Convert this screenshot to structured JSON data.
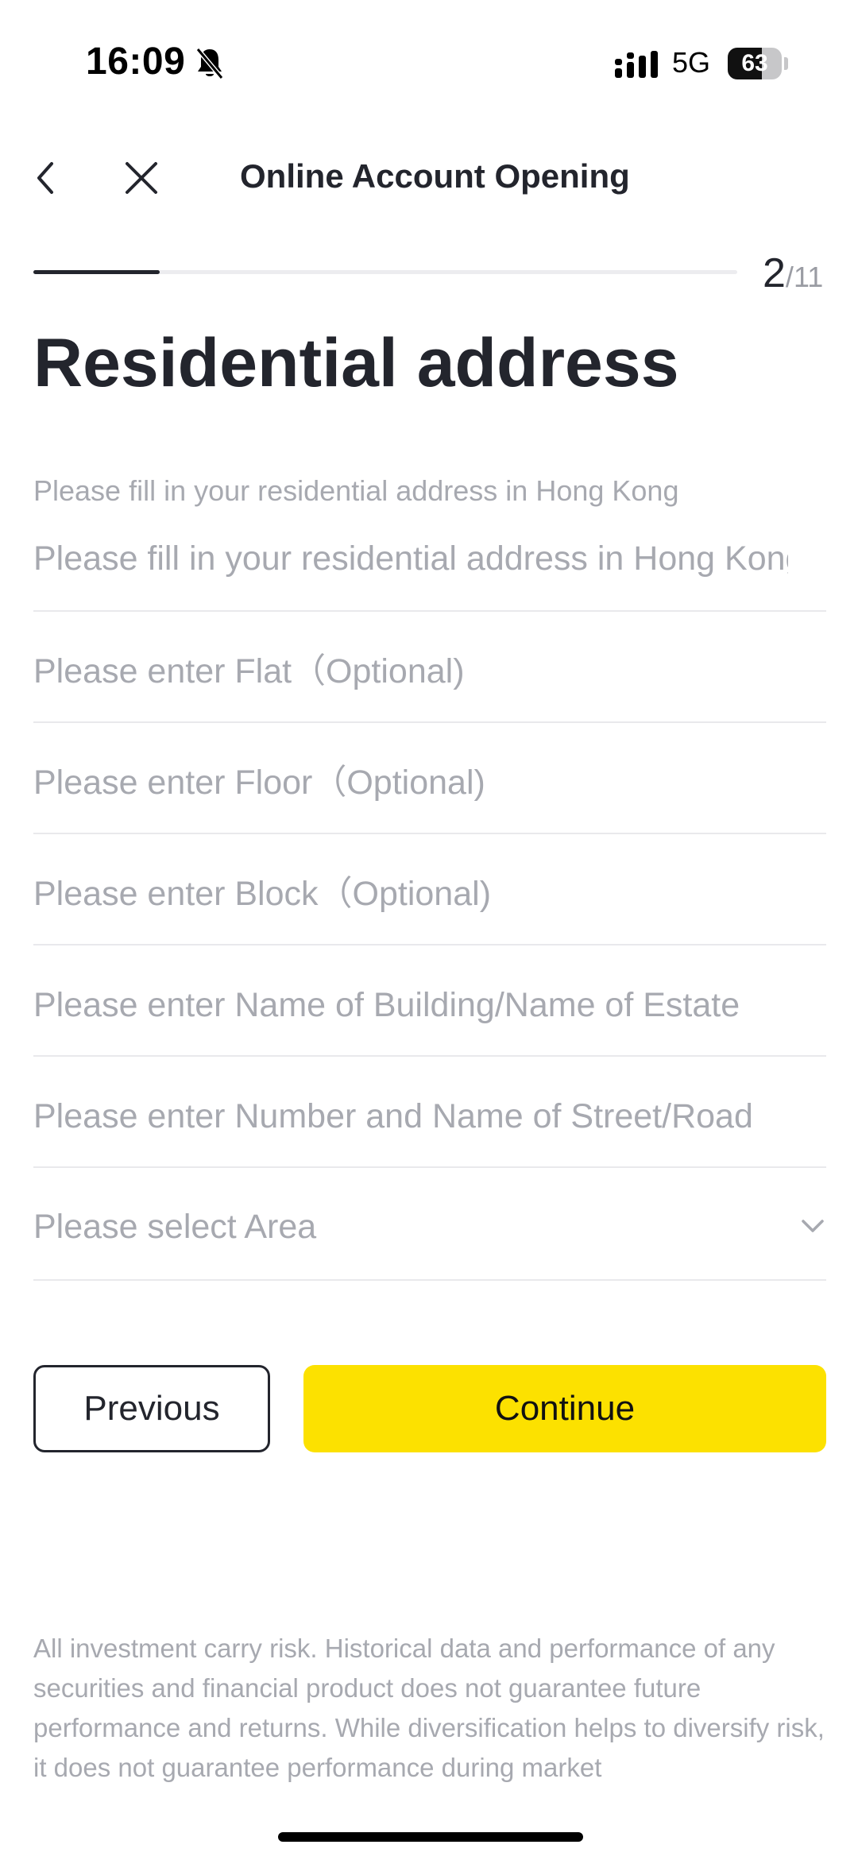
{
  "status_bar": {
    "time": "16:09",
    "network": "5G",
    "battery": "63",
    "battery_level": 0.63,
    "icons": [
      "bell-off-icon",
      "signal-icon",
      "battery-icon"
    ]
  },
  "nav": {
    "title": "Online Account Opening",
    "icons": [
      "chevron-left-icon",
      "close-icon"
    ]
  },
  "progress": {
    "current": "2",
    "separator": "/",
    "total": "11",
    "fraction": 0.18
  },
  "page_title": "Residential address",
  "form": {
    "hint": "Please fill in your residential address in Hong Kong",
    "address_placeholder": "Please fill in your residential address in Hong Kong",
    "flat_placeholder": "Please enter Flat（Optional)",
    "floor_placeholder": "Please enter Floor（Optional)",
    "block_placeholder": "Please enter Block（Optional)",
    "building_placeholder": "Please enter Name of Building/Name of Estate",
    "street_placeholder": "Please enter Number and Name of Street/Road",
    "area_placeholder": "Please select Area"
  },
  "buttons": {
    "previous": "Previous",
    "continue": "Continue"
  },
  "disclaimer": "All investment carry risk. Historical data and performance of any securities and financial product does not guarantee future performance and returns. While diversification helps to diversify risk, it does not guarantee performance during market",
  "colors": {
    "accent": "#fce100",
    "text_primary": "#23252d",
    "text_placeholder": "#a7a9b0",
    "divider": "#e9e9ec"
  }
}
